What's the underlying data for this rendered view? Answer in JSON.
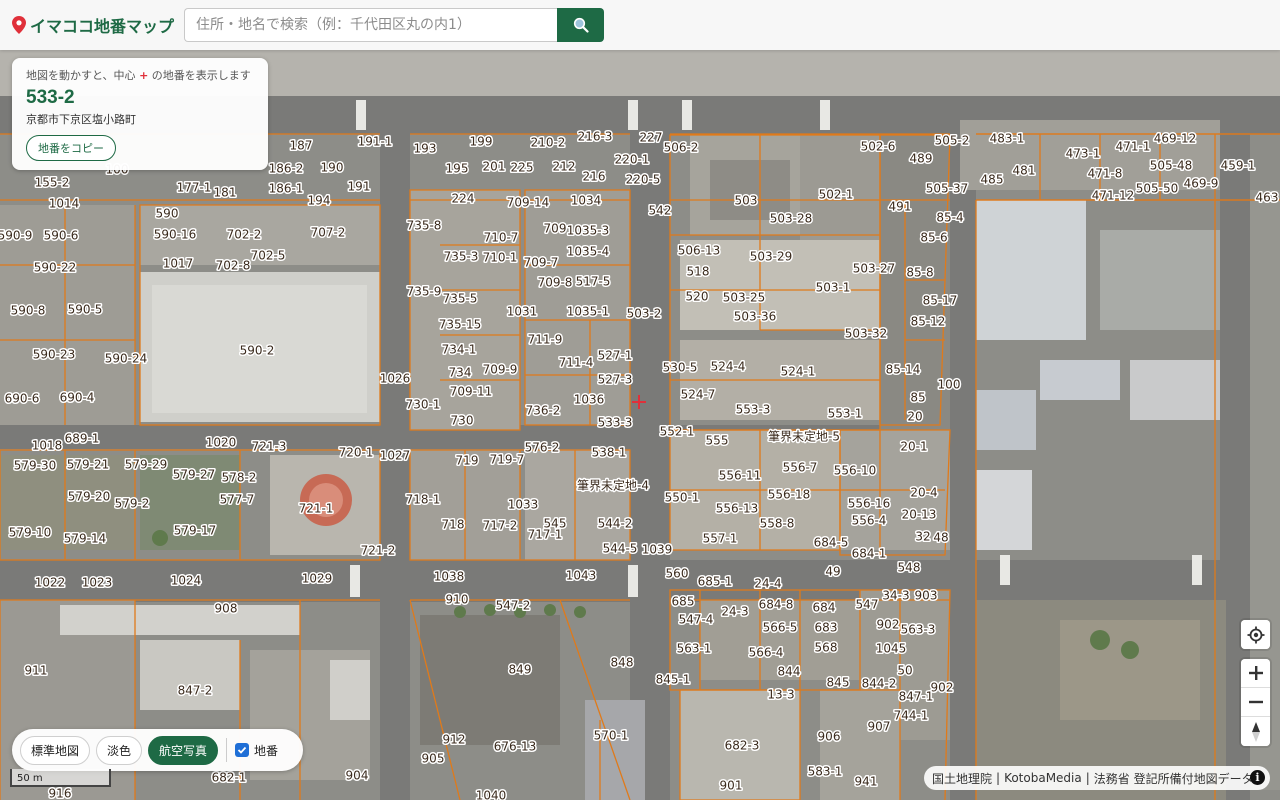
{
  "app": {
    "title": "イマココ地番マップ"
  },
  "search": {
    "placeholder": "住所・地名で検索（例：千代田区丸の内1）"
  },
  "info": {
    "hint_before": "地図を動かすと、中心",
    "hint_marker": "+",
    "hint_after": "の地番を表示します",
    "parcel_number": "533-2",
    "address": "京都市下京区塩小路町",
    "copy_button": "地番をコピー"
  },
  "layers": {
    "standard": "標準地図",
    "pale": "淡色",
    "aerial": "航空写真",
    "active": "aerial",
    "parcel_toggle_label": "地番",
    "parcel_toggle_checked": true
  },
  "scale": {
    "label": "50 m"
  },
  "attribution": {
    "gsi": "国土地理院",
    "kotoba": "KotobaMedia",
    "moj": "法務省 登記所備付地図データ",
    "sep": "|"
  },
  "colors": {
    "brand": "#1e6a45",
    "parcel_line": "#e07a1a",
    "center_marker": "#e0303a"
  },
  "parcel_labels": [
    "191-1",
    "199",
    "210-2",
    "216-3",
    "227",
    "506-2",
    "502-6",
    "505-2",
    "483-1",
    "469-12",
    "187",
    "186-2",
    "190",
    "193",
    "195",
    "201",
    "225",
    "212",
    "220-1",
    "489",
    "473-1",
    "471-1",
    "505-48",
    "155-2",
    "100",
    "177-1",
    "181",
    "186-1",
    "191",
    "216",
    "220-5",
    "505-37",
    "485",
    "481",
    "471-8",
    "469-9",
    "459-1",
    "1014",
    "194",
    "224",
    "709-14",
    "1034",
    "542",
    "503",
    "502-1",
    "491",
    "471-12",
    "505-50",
    "463",
    "590",
    "735-8",
    "709",
    "1035-3",
    "503-28",
    "85-4",
    "590-9",
    "590-6",
    "590-16",
    "702-2",
    "707-2",
    "710-7",
    "85-6",
    "702-5",
    "735-3",
    "710-1",
    "709-7",
    "1035-4",
    "506-13",
    "503-29",
    "590-22",
    "1017",
    "702-8",
    "517-5",
    "518",
    "503-27",
    "85-8",
    "735-9",
    "709-8",
    "520",
    "503-25",
    "503-1",
    "85-17",
    "590-8",
    "590-5",
    "735-5",
    "1031",
    "1035-1",
    "503-2",
    "503-36",
    "85-12",
    "735-15",
    "711-9",
    "503-32",
    "590-23",
    "590-2",
    "734-1",
    "527-1",
    "524-4",
    "524-1",
    "590-24",
    "734",
    "709-9",
    "711-4",
    "530-5",
    "85-14",
    "1026",
    "527-3",
    "100",
    "690-6",
    "690-4",
    "730-1",
    "709-11",
    "1036",
    "524-7",
    "85",
    "736-2",
    "553-3",
    "553-1",
    "730",
    "533-3",
    "20",
    "1018",
    "689-1",
    "1020",
    "721-3",
    "552-1",
    "555",
    "筆界未定地-5",
    "20-1",
    "720-1",
    "1027",
    "576-2",
    "538-1",
    "579-30",
    "579-21",
    "579-29",
    "719",
    "719-7",
    "556-7",
    "556-10",
    "579-27",
    "578-2",
    "556-11",
    "筆界未定地-4",
    "20-4",
    "579-20",
    "577-7",
    "718-1",
    "1033",
    "550-1",
    "556-18",
    "579-2",
    "721-1",
    "556-13",
    "556-16",
    "20-13",
    "718",
    "717-2",
    "545",
    "544-2",
    "556-4",
    "558-8",
    "579-17",
    "579-10",
    "579-14",
    "717-1",
    "557-1",
    "32",
    "48",
    "721-2",
    "544-5",
    "1039",
    "684-5",
    "684-1",
    "1022",
    "1023",
    "1024",
    "1029",
    "1038",
    "1043",
    "49",
    "548",
    "560",
    "685-1",
    "24-4",
    "34-3",
    "903",
    "908",
    "910",
    "547-2",
    "685",
    "684-8",
    "684",
    "547",
    "547-4",
    "24-3",
    "563-3",
    "566-5",
    "683",
    "902",
    "911",
    "849",
    "848",
    "563-1",
    "566-4",
    "568",
    "1045",
    "844",
    "50",
    "902",
    "847-2",
    "845-1",
    "845",
    "844-2",
    "847-1",
    "13-3",
    "744-1",
    "907",
    "912",
    "676-13",
    "570-1",
    "682-3",
    "906",
    "905",
    "904",
    "682-1",
    "583-1",
    "941",
    "901",
    "916",
    "1040"
  ]
}
